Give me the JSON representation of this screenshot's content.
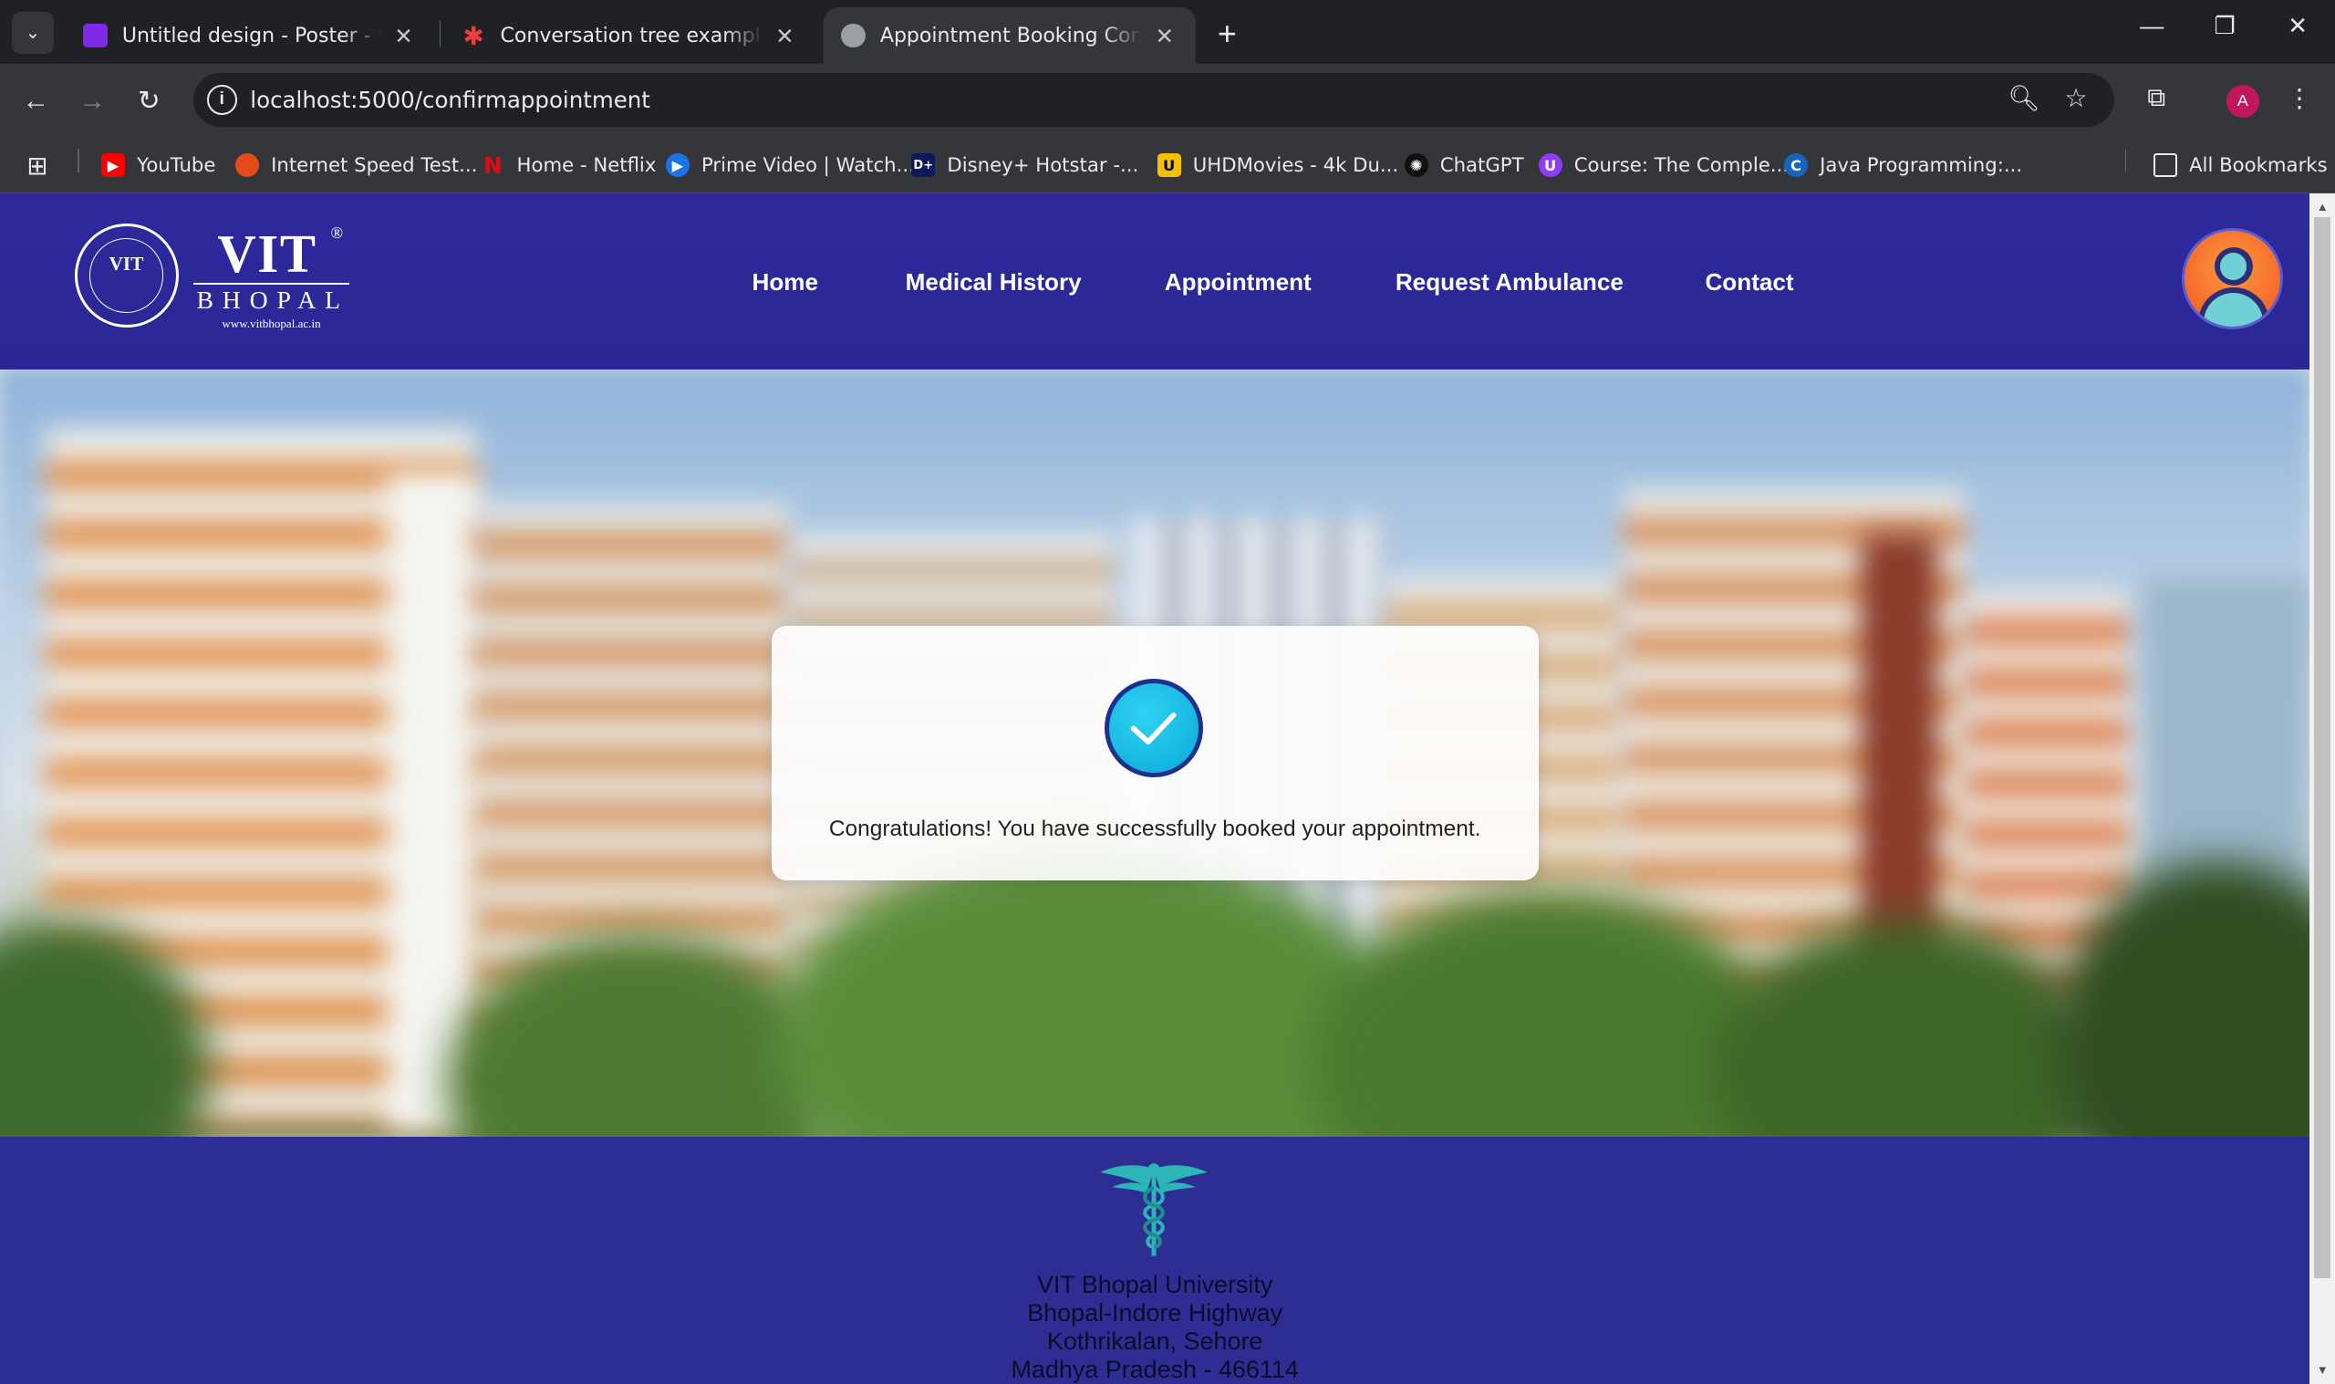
{
  "browser": {
    "tabs": [
      {
        "title": "Untitled design - Poster - Canva",
        "favicon_color": "#7d2ae8",
        "active": false
      },
      {
        "title": "Conversation tree example: Lucidchart",
        "favicon_color": "#f03e3e",
        "active": false
      },
      {
        "title": "Appointment Booking Confirmation",
        "favicon_color": "#9aa0a6",
        "active": true
      }
    ],
    "url": "localhost:5000/confirmappointment",
    "profile_initial": "A",
    "bookmarks": [
      {
        "label": "YouTube",
        "icon_color": "#ff0000"
      },
      {
        "label": "Internet Speed Test...",
        "icon_color": "#e64a19"
      },
      {
        "label": "Home - Netflix",
        "icon_color": "#e50914"
      },
      {
        "label": "Prime Video | Watch...",
        "icon_color": "#1a73e8"
      },
      {
        "label": "Disney+ Hotstar -...",
        "icon_color": "#0c1a5c"
      },
      {
        "label": "UHDMovies - 4k Du...",
        "icon_color": "#f2c200"
      },
      {
        "label": "ChatGPT",
        "icon_color": "#111111"
      },
      {
        "label": "Course: The Comple...",
        "icon_color": "#8e3cf7"
      },
      {
        "label": "Java Programming:...",
        "icon_color": "#1565c0"
      }
    ],
    "all_bookmarks_label": "All Bookmarks"
  },
  "site": {
    "logo": {
      "main": "VIT",
      "reg": "®",
      "sub": "BHOPAL",
      "website": "www.vitbhopal.ac.in",
      "seal_text": "VIT"
    },
    "nav": [
      "Home",
      "Medical History",
      "Appointment",
      "Request Ambulance",
      "Contact"
    ],
    "confirmation_message": "Congratulations! You have successfully booked your appointment.",
    "footer": {
      "address_lines": [
        "VIT Bhopal University",
        "Bhopal-Indore Highway",
        "Kothrikalan, Sehore",
        "Madhya Pradesh - 466114"
      ]
    },
    "colors": {
      "header": "#2e2a9c",
      "footer": "#2d2d94",
      "check": "#09a9d8"
    }
  }
}
